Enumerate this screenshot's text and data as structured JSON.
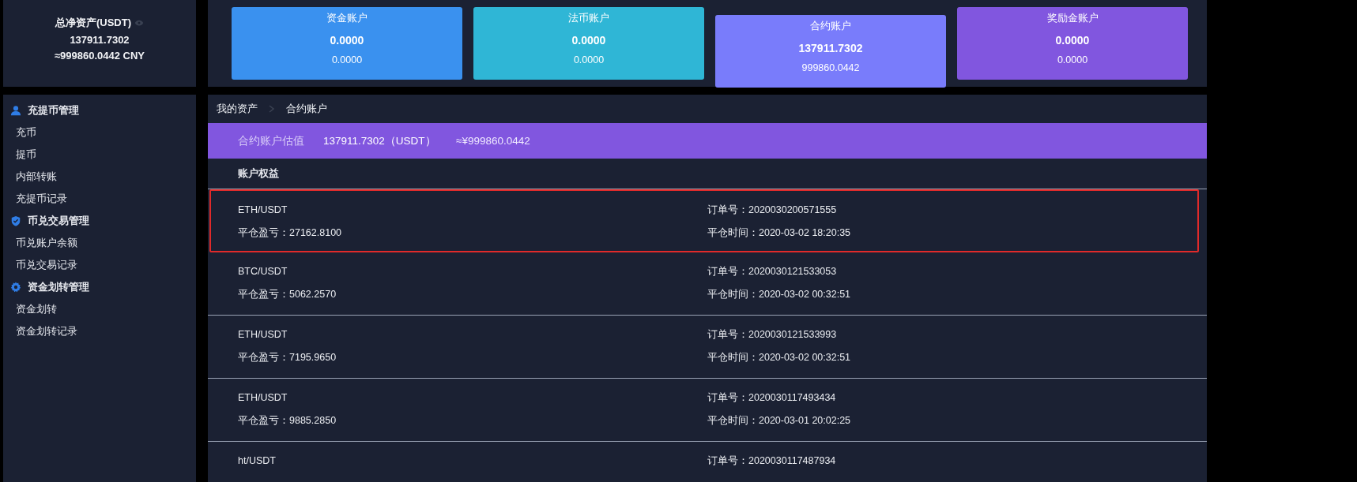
{
  "summary": {
    "title": "总净资产(USDT)",
    "amount": "137911.7302",
    "cny": "≈999860.0442 CNY"
  },
  "sidebar": {
    "groups": [
      {
        "title": "充提币管理",
        "items": [
          {
            "label": "充币"
          },
          {
            "label": "提币"
          },
          {
            "label": "内部转账"
          },
          {
            "label": "充提币记录"
          }
        ]
      },
      {
        "title": "币兑交易管理",
        "items": [
          {
            "label": "币兑账户余额"
          },
          {
            "label": "币兑交易记录"
          }
        ]
      },
      {
        "title": "资金划转管理",
        "items": [
          {
            "label": "资金划转"
          },
          {
            "label": "资金划转记录"
          }
        ]
      }
    ]
  },
  "account_cards": [
    {
      "title": "资金账户",
      "amount": "0.0000",
      "cny": "0.0000",
      "color": "#3a91ef",
      "selected": false
    },
    {
      "title": "法币账户",
      "amount": "0.0000",
      "cny": "0.0000",
      "color": "#2fb6d6",
      "selected": false
    },
    {
      "title": "合约账户",
      "amount": "137911.7302",
      "cny": "999860.0442",
      "color": "#797cfb",
      "selected": true
    },
    {
      "title": "奖励金账户",
      "amount": "0.0000",
      "cny": "0.0000",
      "color": "#8156df",
      "selected": false
    }
  ],
  "breadcrumb": [
    "我的资产",
    "合约账户"
  ],
  "valuation": {
    "label": "合约账户估值",
    "amount": "137911.7302（USDT）",
    "cny": "≈¥999860.0442"
  },
  "section_title": "账户权益",
  "records": [
    {
      "pair": "ETH/USDT",
      "pnl": "平仓盈亏：27162.8100",
      "order": "订单号：2020030200571555",
      "time": "平仓时间：2020-03-02 18:20:35",
      "highlighted": true
    },
    {
      "pair": "BTC/USDT",
      "pnl": "平仓盈亏：5062.2570",
      "order": "订单号：2020030121533053",
      "time": "平仓时间：2020-03-02 00:32:51",
      "highlighted": false
    },
    {
      "pair": "ETH/USDT",
      "pnl": "平仓盈亏：7195.9650",
      "order": "订单号：2020030121533993",
      "time": "平仓时间：2020-03-02 00:32:51",
      "highlighted": false
    },
    {
      "pair": "ETH/USDT",
      "pnl": "平仓盈亏：9885.2850",
      "order": "订单号：2020030117493434",
      "time": "平仓时间：2020-03-01 20:02:25",
      "highlighted": false
    },
    {
      "pair": "ht/USDT",
      "order": "订单号：2020030117487934",
      "highlighted": false
    }
  ]
}
